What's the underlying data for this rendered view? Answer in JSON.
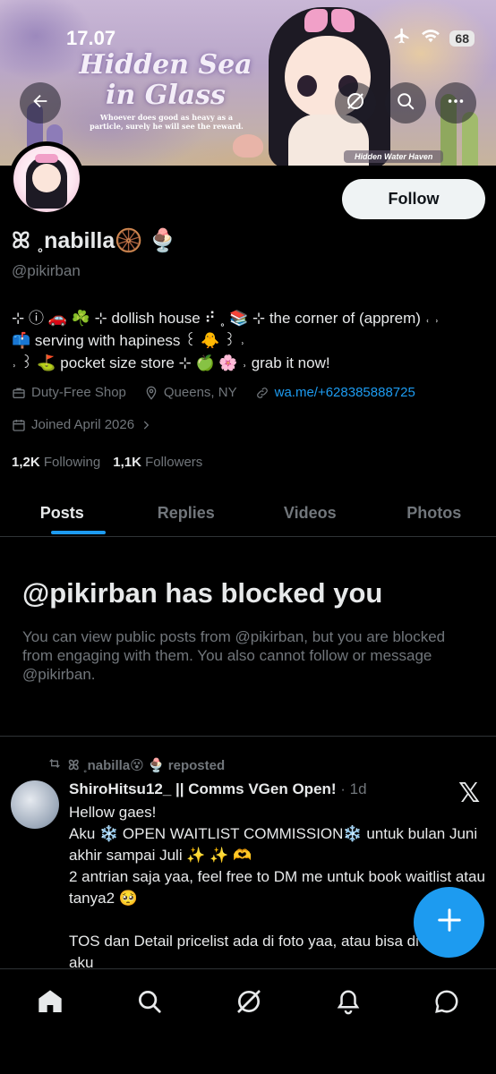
{
  "status_bar": {
    "time": "17.07",
    "battery": "68"
  },
  "banner": {
    "title": "Hidden Sea in Glass",
    "subtitle": "Whoever does good as heavy as a particle, surely he will see the reward.",
    "sign": "Hidden Water Haven"
  },
  "profile": {
    "display_name": "ꕤ ˳nabilla🛞 🍨",
    "handle": "@pikirban",
    "follow_label": "Follow",
    "bio_lines": [
      "⊹ ⓘ 🚗 ☘️ ⊹ dollish house ⠞ ˳ 📚 ⊹ the corner of (apprem) ˓ ˒",
      "📫 serving with hapiness ꒰ 🐥 ꒱ ˒",
      "˒ ꒱ ⛳️ pocket size store ⊹ 🍏 🌸 ˒ grab it now!"
    ],
    "category": "Duty-Free Shop",
    "location": "Queens, NY",
    "website": "wa.me/+628385888725",
    "joined": "Joined April 2026",
    "following_count": "1,2K",
    "following_label": "Following",
    "followers_count": "1,1K",
    "followers_label": "Followers"
  },
  "tabs": [
    {
      "label": "Posts",
      "active": true
    },
    {
      "label": "Replies",
      "active": false
    },
    {
      "label": "Videos",
      "active": false
    },
    {
      "label": "Photos",
      "active": false
    }
  ],
  "blocked": {
    "title": "@pikirban has blocked you",
    "message": "You can view public posts from @pikirban, but you are blocked from engaging with them. You also cannot follow or message @pikirban."
  },
  "post": {
    "repost_text": "ꕤ ˳nabilla😵 🍨 reposted",
    "author": "ShiroHitsu12_ || Comms VGen Open!",
    "time": " · 1d",
    "body": "Hellow gaes!\nAku ❄️ OPEN WAITLIST COMMISSION❄️ untuk bulan Juni akhir sampai Juli ✨ ✨ 🫶\n2 antrian saja yaa, feel free to DM me untuk book waitlist atau tanya2 🥺\n\nTOS dan Detail pricelist ada di foto yaa, atau bisa di carrd aku"
  },
  "icons": {
    "back": "arrow-left-icon",
    "grok": "grok-icon",
    "search": "search-icon",
    "more": "more-icon",
    "fab": "plus-icon",
    "nav": [
      "home-icon",
      "search-icon",
      "grok-icon",
      "bell-icon",
      "message-icon"
    ]
  },
  "colors": {
    "accent": "#1d9bf0",
    "background": "#000000",
    "muted": "#71767b",
    "text": "#e7e9ea"
  }
}
